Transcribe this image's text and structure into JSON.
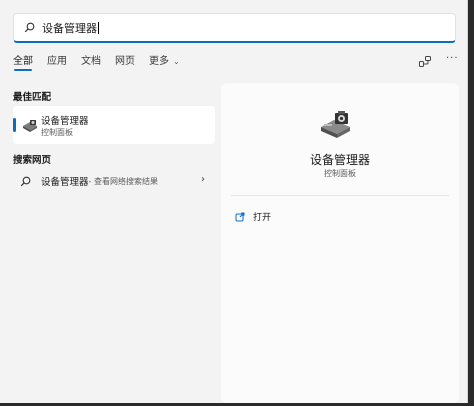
{
  "search": {
    "query": "设备管理器",
    "icon": "search-icon"
  },
  "tabs": [
    {
      "label": "全部",
      "active": true
    },
    {
      "label": "应用",
      "active": false
    },
    {
      "label": "文档",
      "active": false
    },
    {
      "label": "网页",
      "active": false
    },
    {
      "label": "更多",
      "active": false
    }
  ],
  "toolbar": {
    "more_label": "···"
  },
  "best_match": {
    "section_title": "最佳匹配",
    "name": "设备管理器",
    "subtitle": "控制面板"
  },
  "web_search": {
    "section_title": "搜索网页",
    "label": "设备管理器",
    "desc": " - 查看网络搜索结果"
  },
  "detail": {
    "title": "设备管理器",
    "subtitle": "控制面板",
    "actions": [
      {
        "label": "打开",
        "icon": "open-external-icon"
      }
    ]
  },
  "colors": {
    "accent": "#0f6cbd",
    "panel": "#f3f3f3",
    "card": "#ffffff"
  }
}
